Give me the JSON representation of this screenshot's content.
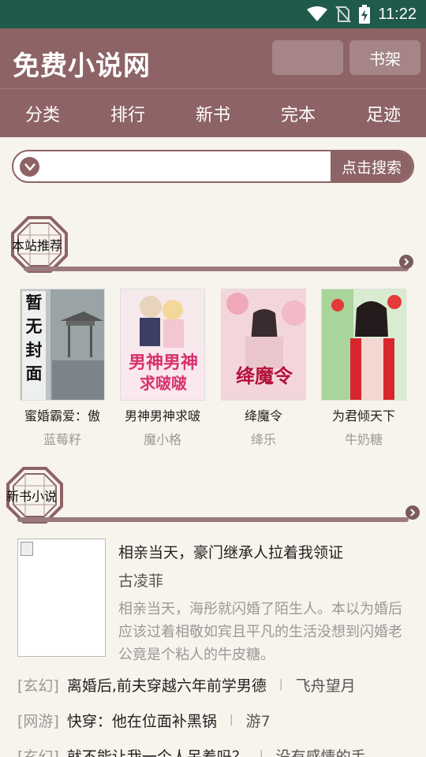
{
  "status_bar": {
    "time": "11:22",
    "bg": "#1f5a4a"
  },
  "header": {
    "title": "免费小说网",
    "shelf_label": "书架",
    "bg": "#8d6366"
  },
  "nav": {
    "items": [
      "分类",
      "排行",
      "新书",
      "完本",
      "足迹"
    ]
  },
  "search": {
    "placeholder": "",
    "button_label": "点击搜索"
  },
  "recommend": {
    "title": "本站推荐",
    "books": [
      {
        "title": "蜜婚霸爱：傲",
        "author": "蓝莓籽",
        "cover_text": "暂无封面"
      },
      {
        "title": "男神男神求啵",
        "author": "魔小格",
        "cover_text": "男神男神求啵啵"
      },
      {
        "title": "绛魔令",
        "author": "绛乐",
        "cover_text": "绛魔令"
      },
      {
        "title": "为君倾天下",
        "author": "牛奶糖",
        "cover_text": ""
      }
    ]
  },
  "newbooks": {
    "title": "新书小说",
    "featured": {
      "title": "相亲当天，豪门继承人拉着我领证",
      "author": "古凌菲",
      "desc": "相亲当天，海彤就闪婚了陌生人。本以为婚后应该过着相敬如宾且平凡的生活没想到闪婚老公竟是个粘人的牛皮糖。"
    },
    "list": [
      {
        "category": "[玄幻]",
        "title": "离婚后,前夫穿越六年前学男德",
        "sep": "|",
        "author": "飞舟望月"
      },
      {
        "category": "[网游]",
        "title": "快穿：他在位面补黑锅",
        "sep": "|",
        "author": "游7"
      },
      {
        "category": "[玄幻]",
        "title": "就不能让我一个人呆着吗？",
        "sep": "|",
        "author": "没有感情的手"
      }
    ]
  }
}
